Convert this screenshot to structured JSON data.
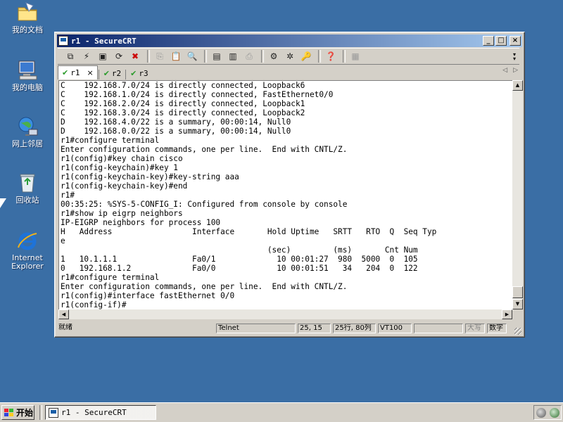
{
  "desktop": {
    "icons": [
      {
        "label": "我的文档"
      },
      {
        "label": "我的电脑"
      },
      {
        "label": "网上邻居"
      },
      {
        "label": "回收站"
      },
      {
        "label": "Internet\nExplorer"
      }
    ]
  },
  "window": {
    "title": "r1 - SecureCRT",
    "controls": {
      "minimize": "_",
      "maximize": "□",
      "close": "×"
    }
  },
  "tabs": [
    {
      "label": "r1",
      "active": true,
      "close": "×"
    },
    {
      "label": "r2",
      "active": false
    },
    {
      "label": "r3",
      "active": false
    }
  ],
  "tab_nav": {
    "prev": "◁",
    "next": "▷"
  },
  "terminal": {
    "lines": [
      "C    192.168.7.0/24 is directly connected, Loopback6",
      "C    192.168.1.0/24 is directly connected, FastEthernet0/0",
      "C    192.168.2.0/24 is directly connected, Loopback1",
      "C    192.168.3.0/24 is directly connected, Loopback2",
      "D    192.168.4.0/22 is a summary, 00:00:14, Null0",
      "D    192.168.0.0/22 is a summary, 00:00:14, Null0",
      "r1#configure terminal",
      "Enter configuration commands, one per line.  End with CNTL/Z.",
      "r1(config)#key chain cisco",
      "r1(config-keychain)#key 1",
      "r1(config-keychain-key)#key-string aaa",
      "r1(config-keychain-key)#end",
      "r1#",
      "00:35:25: %SYS-5-CONFIG_I: Configured from console by console",
      "r1#show ip eigrp neighbors",
      "IP-EIGRP neighbors for process 100",
      "H   Address                 Interface       Hold Uptime   SRTT   RTO  Q  Seq Typ",
      "e",
      "                                            (sec)         (ms)       Cnt Num",
      "1   10.1.1.1                Fa0/1             10 00:01:27  980  5000  0  105",
      "0   192.168.1.2             Fa0/0             10 00:01:51   34   204  0  122",
      "r1#configure terminal",
      "Enter configuration commands, one per line.  End with CNTL/Z.",
      "r1(config)#interface fastEthernet 0/0",
      "r1(config-if)#"
    ]
  },
  "scrollbar": {
    "up": "▲",
    "down": "▼",
    "left": "◀",
    "right": "▶"
  },
  "statusbar": {
    "ready": "就绪",
    "protocol": "Telnet",
    "cursor_pos": "25, 15",
    "rows_cols": "25行, 80列",
    "emulation": "VT100",
    "blank": "",
    "caps": "大写",
    "num": "数字"
  },
  "taskbar": {
    "start_label": "开始",
    "tasks": [
      {
        "label": "r1 - SecureCRT"
      }
    ]
  }
}
